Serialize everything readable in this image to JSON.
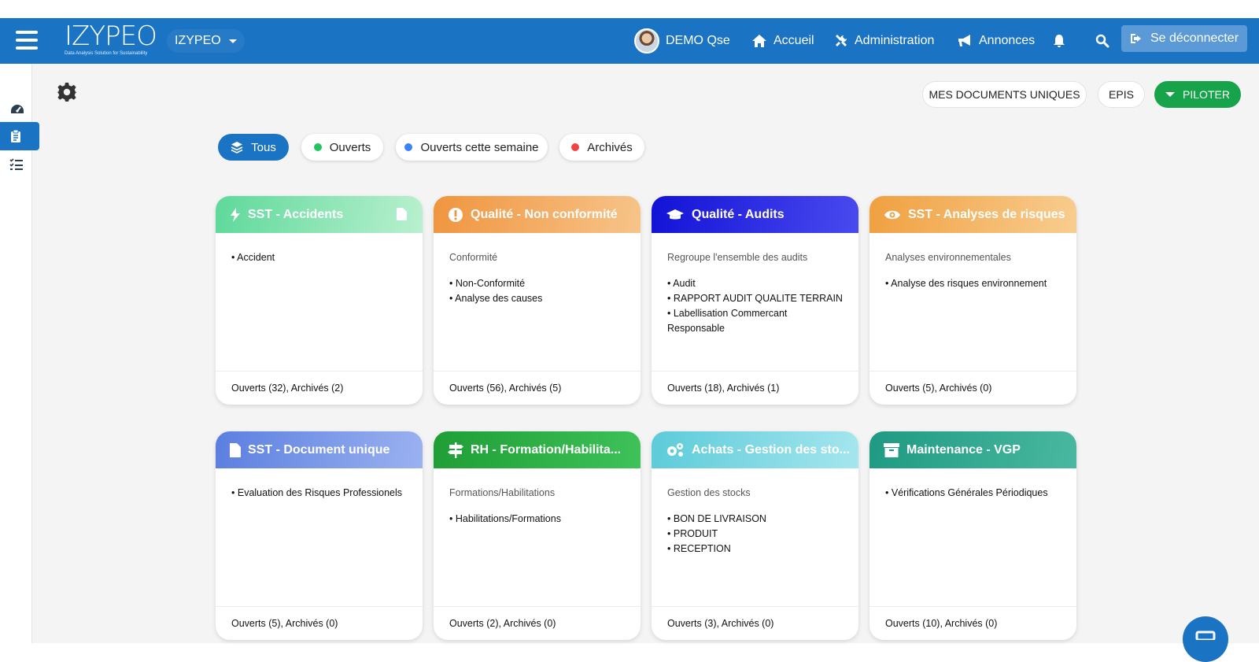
{
  "header": {
    "logo_text": "IZYPEO",
    "logo_tagline": "Data Analysis Solution for Sustainability",
    "brand_select": "IZYPEO",
    "user_name": "DEMO Qse",
    "nav": {
      "home": "Accueil",
      "admin": "Administration",
      "announcements": "Annonces"
    },
    "logout": "Se déconnecter"
  },
  "toolbar": {
    "mes_documents": "MES DOCUMENTS UNIQUES",
    "epis": "EPIS",
    "piloter": "PILOTER"
  },
  "filters": [
    {
      "label": "Tous"
    },
    {
      "label": "Ouverts",
      "color": "#22c55e"
    },
    {
      "label": "Ouverts cette semaine",
      "color": "#3b82f6"
    },
    {
      "label": "Archivés",
      "color": "#ef4444"
    }
  ],
  "cards": [
    {
      "title": "SST - Accidents",
      "icon": "bolt-icon",
      "color": "#5ed99a",
      "description": "",
      "items": [
        "Accident"
      ],
      "footer": "Ouverts (32), Archivés (2)"
    },
    {
      "title": "Qualité - Non conformité",
      "icon": "exclamation-circle-icon",
      "color": "#f0953e",
      "description": "Conformité",
      "items": [
        "Non-Conformité",
        "Analyse des causes"
      ],
      "footer": "Ouverts (56), Archivés (5)"
    },
    {
      "title": "Qualité - Audits",
      "icon": "graduation-cap-icon",
      "color": "#1a1adb",
      "description": "Regroupe l'ensemble des audits",
      "items": [
        "Audit",
        "RAPPORT AUDIT QUALITE TERRAIN",
        "Labellisation Commercant Responsable"
      ],
      "footer": "Ouverts (18), Archivés (1)"
    },
    {
      "title": "SST - Analyses de risques",
      "icon": "eye-icon",
      "color": "#f0a040",
      "description": "Analyses environnementales",
      "items": [
        "Analyse des risques environnement"
      ],
      "footer": "Ouverts (5), Archivés (0)"
    },
    {
      "title": "SST - Document unique",
      "icon": "file-icon",
      "color": "#5b7fe0",
      "description": "",
      "items": [
        "Evaluation des Risques Professionels"
      ],
      "footer": "Ouverts (5), Archivés (0)"
    },
    {
      "title": "RH - Formation/Habilita...",
      "icon": "signpost-icon",
      "color": "#22a83a",
      "description": "Formations/Habilitations",
      "items": [
        "Habilitations/Formations"
      ],
      "footer": "Ouverts (2), Archivés (0)"
    },
    {
      "title": "Achats - Gestion des sto...",
      "icon": "gears-icon",
      "color": "#5ccbd9",
      "description": "Gestion des stocks",
      "items": [
        "BON DE LIVRAISON",
        "PRODUIT",
        "RECEPTION"
      ],
      "footer": "Ouverts (3), Archivés (0)"
    },
    {
      "title": "Maintenance - VGP",
      "icon": "archive-icon",
      "color": "#1f9a82",
      "description": "",
      "items": [
        "Vérifications Générales Périodiques"
      ],
      "footer": "Ouverts (10), Archivés (0)"
    }
  ]
}
